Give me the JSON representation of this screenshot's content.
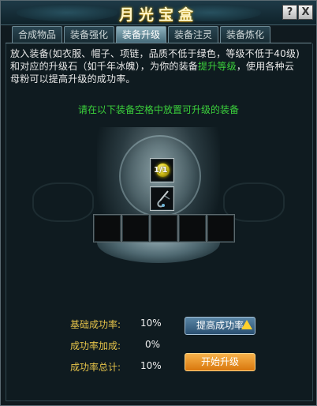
{
  "window": {
    "title": "月光宝盒",
    "help_label": "?",
    "close_label": "X"
  },
  "tabs": [
    {
      "label": "合成物品",
      "active": false
    },
    {
      "label": "装备强化",
      "active": false
    },
    {
      "label": "装备升级",
      "active": true
    },
    {
      "label": "装备注灵",
      "active": false
    },
    {
      "label": "装备炼化",
      "active": false
    }
  ],
  "description": {
    "part1": "放入装备(如衣服、帽子、项链，品质不低于绿色，等级不低于40级)和对应的升级石（如千年冰魄），为你的装备",
    "highlight": "提升等级",
    "part2": "，使用各种云母粉可以提高升级的成功率。"
  },
  "hint": "请在以下装备空格中放置可升级的装备",
  "slots": {
    "stone_count": "1/1",
    "stone_icon": "yellow-orb-icon",
    "hook_icon": "hook-item-icon",
    "empty_slot_count": 5
  },
  "stats": {
    "base_label": "基础成功率:",
    "base_value": "10%",
    "bonus_label": "成功率加成:",
    "bonus_value": "0%",
    "total_label": "成功率总计:",
    "total_value": "10%"
  },
  "buttons": {
    "raise_label": "提高成功率",
    "start_label": "开始升级"
  },
  "colors": {
    "hint_green": "#3bd13b",
    "stat_gold": "#e6c44a",
    "start_orange": "#e88a1c"
  }
}
